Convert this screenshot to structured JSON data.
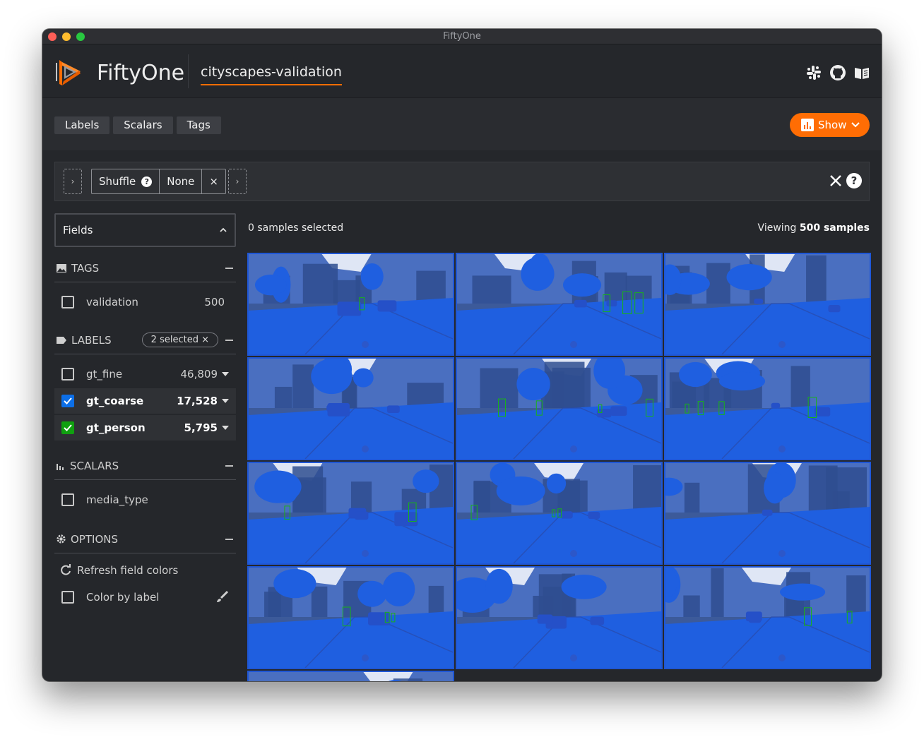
{
  "window": {
    "title": "FiftyOne"
  },
  "header": {
    "brand": "FiftyOne",
    "dataset": "cityscapes-validation",
    "icons": [
      "slack-icon",
      "github-icon",
      "docs-book-icon"
    ]
  },
  "toolbar": {
    "tabs": [
      "Labels",
      "Scalars",
      "Tags"
    ],
    "show_label": "Show"
  },
  "view_bar": {
    "stage_name": "Shuffle",
    "stage_value": "None"
  },
  "sidebar": {
    "fields_label": "Fields",
    "tags": {
      "title": "TAGS",
      "items": [
        {
          "name": "validation",
          "count": "500"
        }
      ]
    },
    "labels": {
      "title": "LABELS",
      "selected_pill": "2 selected",
      "items": [
        {
          "name": "gt_fine",
          "count": "46,809",
          "checked": false
        },
        {
          "name": "gt_coarse",
          "count": "17,528",
          "checked": true,
          "color": "#0c6fe8"
        },
        {
          "name": "gt_person",
          "count": "5,795",
          "checked": true,
          "color": "#10a010"
        }
      ]
    },
    "scalars": {
      "title": "SCALARS",
      "items": [
        {
          "name": "media_type"
        }
      ]
    },
    "options": {
      "title": "OPTIONS",
      "refresh_label": "Refresh field colors",
      "color_by_label": "Color by label"
    }
  },
  "content": {
    "selected_text": "0 samples selected",
    "viewing_prefix": "Viewing",
    "viewing_count": "500 samples"
  },
  "colors": {
    "accent": "#ff6d04",
    "coarse_mask": "#1f5fe0",
    "person_box": "#18b318",
    "background": "#25272b"
  }
}
